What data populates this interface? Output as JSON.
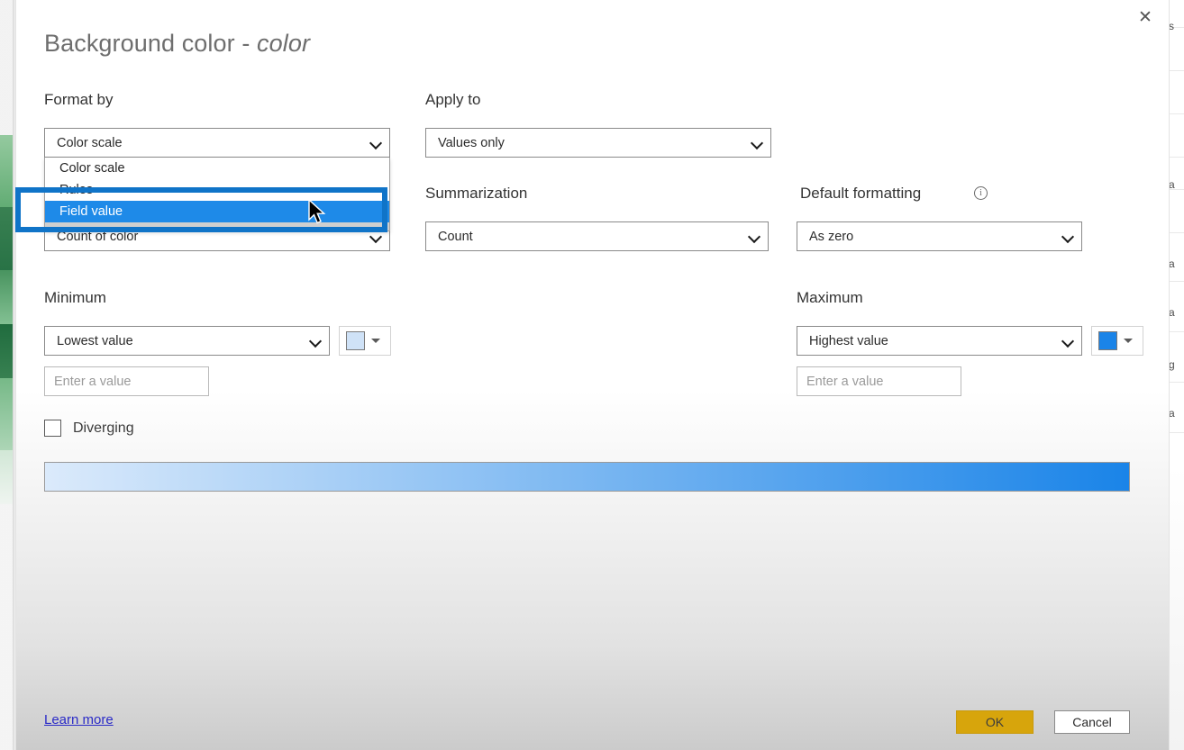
{
  "dialog": {
    "title_main": "Background color - ",
    "title_field": "color",
    "close_icon": "close-icon"
  },
  "format_by": {
    "label": "Format by",
    "selected": "Color scale",
    "options": [
      "Color scale",
      "Rules",
      "Field value"
    ],
    "highlighted_option": "Field value"
  },
  "based_on_field": {
    "selected": "Count of color"
  },
  "apply_to": {
    "label": "Apply to",
    "selected": "Values only"
  },
  "summarization": {
    "label": "Summarization",
    "selected": "Count"
  },
  "default_formatting": {
    "label": "Default formatting",
    "info_icon": "info-icon",
    "selected": "As zero"
  },
  "minimum": {
    "label": "Minimum",
    "selected": "Lowest value",
    "value": "",
    "placeholder": "Enter a value",
    "color": "#cfe2f7"
  },
  "maximum": {
    "label": "Maximum",
    "selected": "Highest value",
    "value": "",
    "placeholder": "Enter a value",
    "color": "#1a84e8"
  },
  "diverging": {
    "label": "Diverging",
    "checked": false
  },
  "gradient": {
    "from": "#dbeafb",
    "to": "#1a84e8"
  },
  "footer": {
    "learn_more": "Learn more",
    "ok": "OK",
    "cancel": "Cancel",
    "ok_color": "#d7a50c"
  },
  "background_fragments": [
    "s",
    "a",
    "a",
    "a",
    "g",
    "a"
  ]
}
